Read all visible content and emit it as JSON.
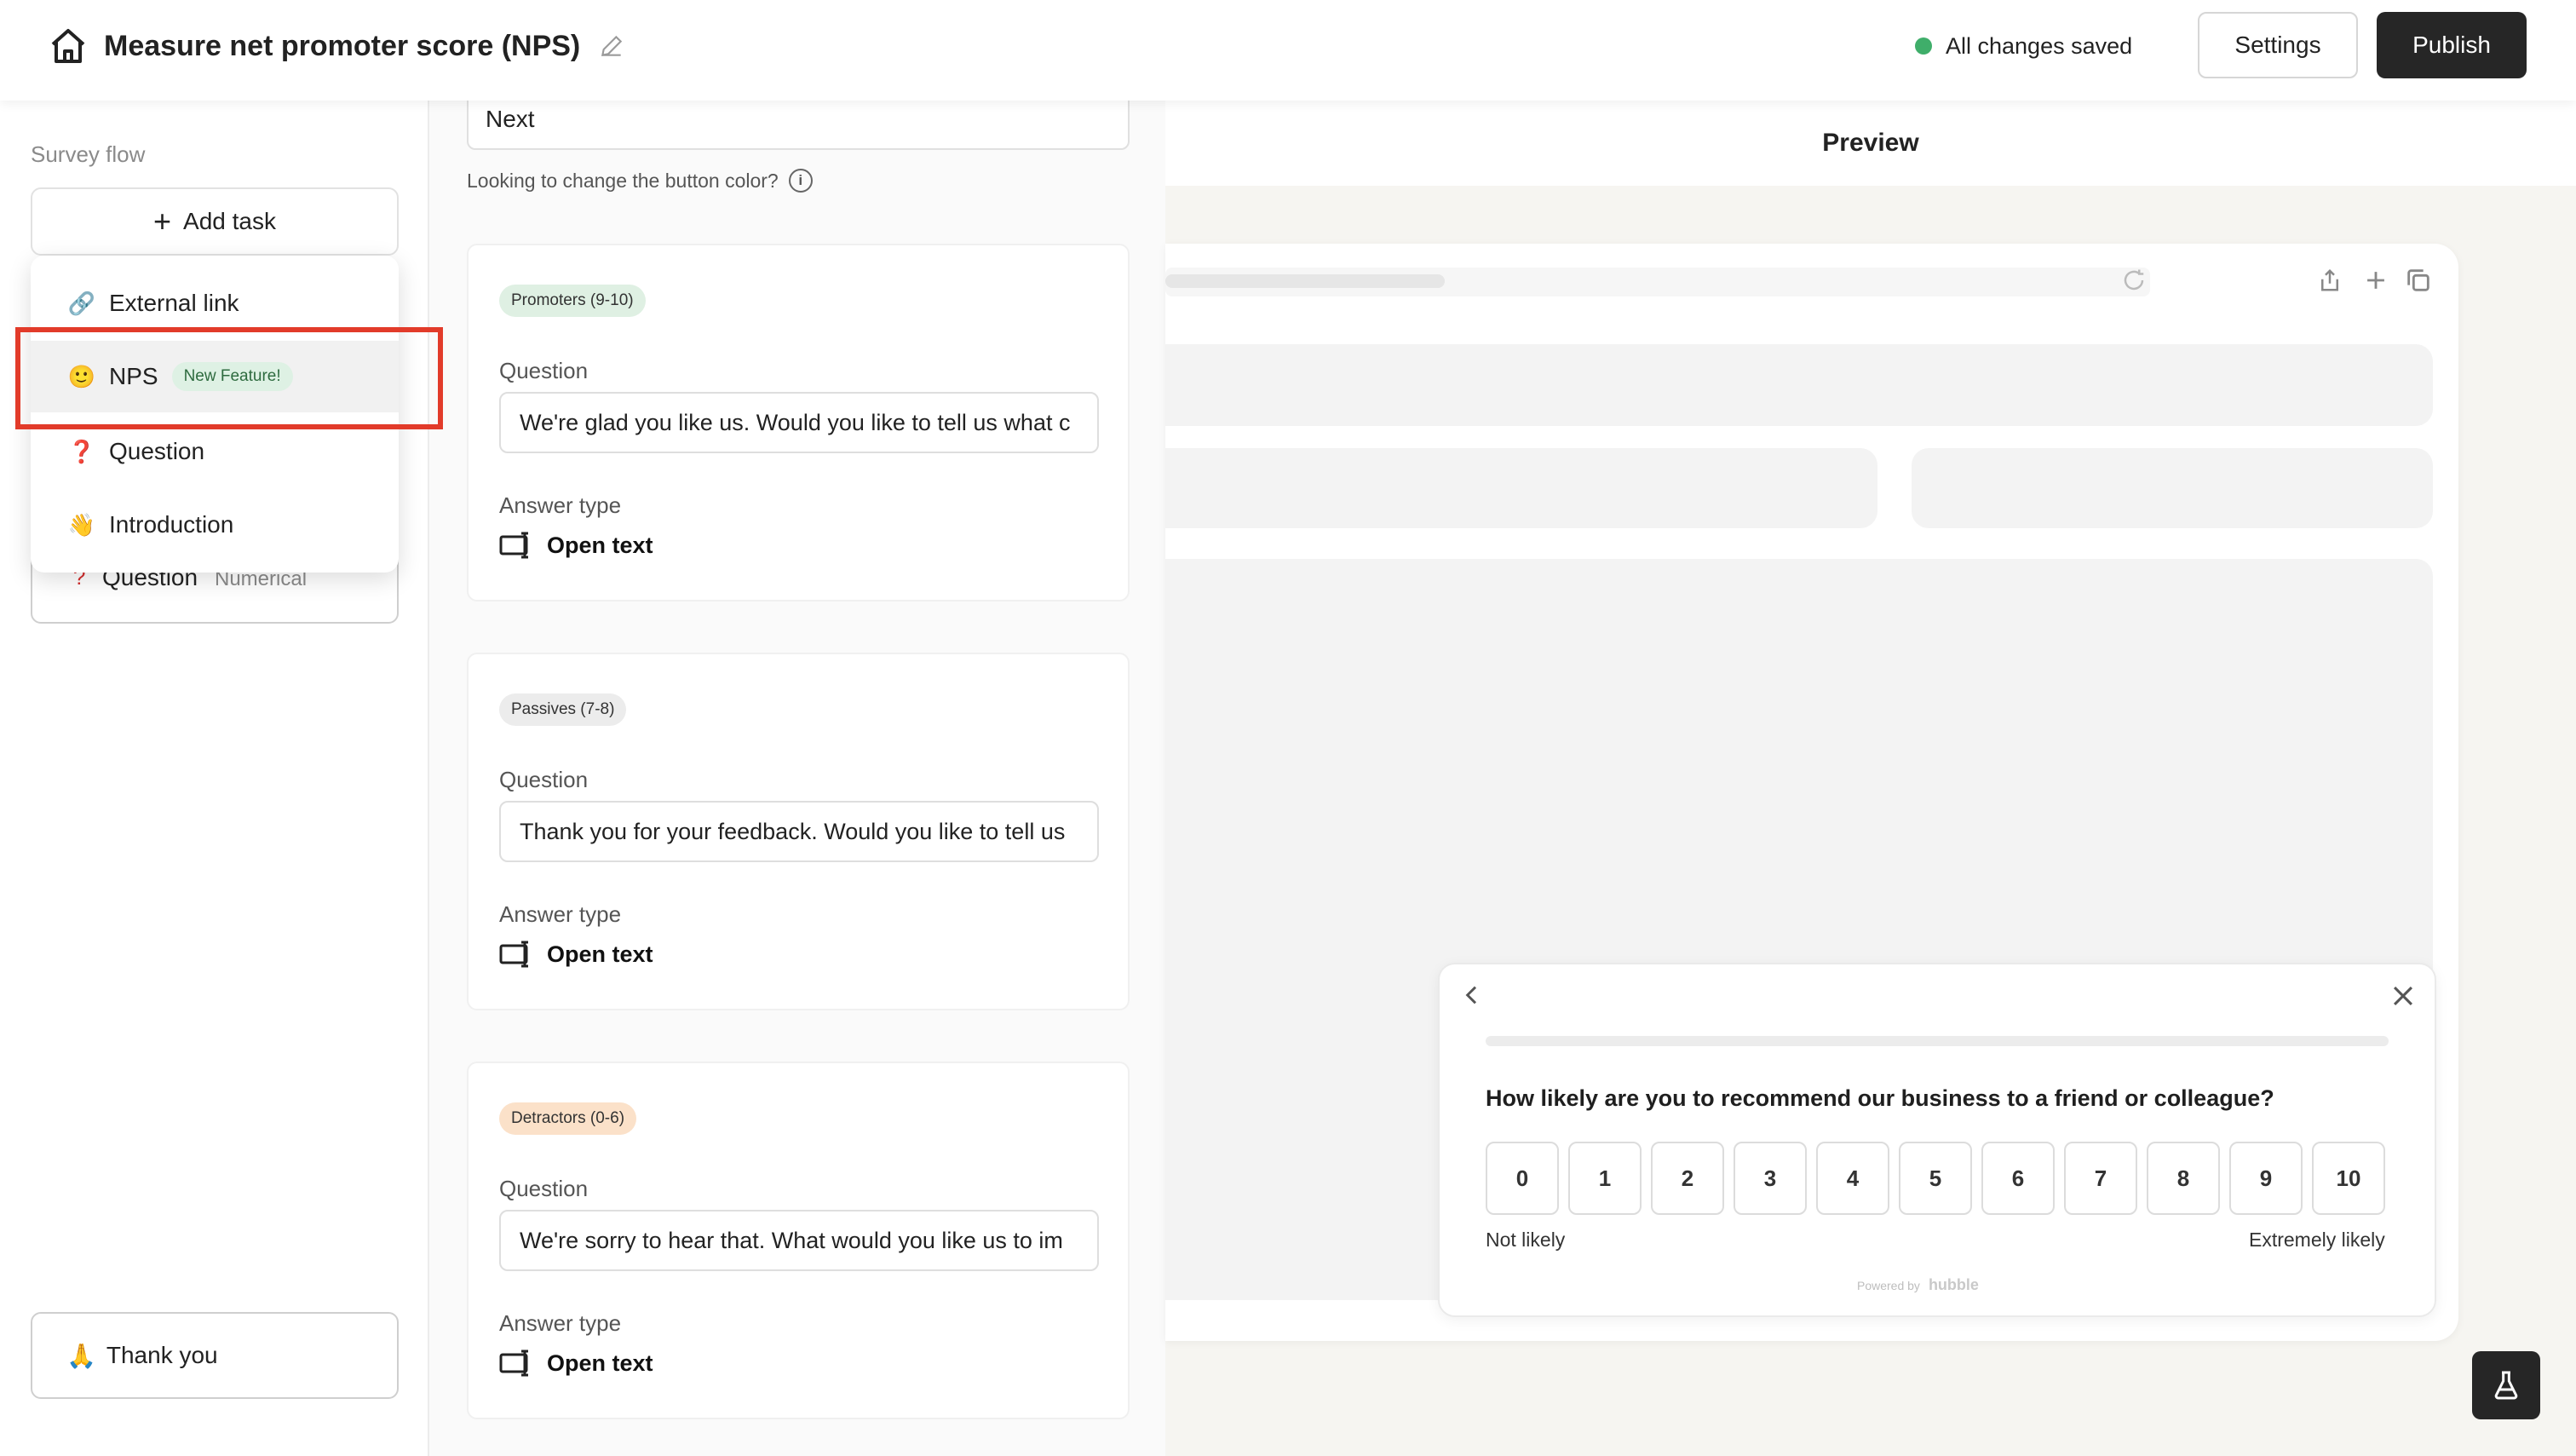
{
  "header": {
    "title": "Measure net promoter score (NPS)",
    "status": "All changes saved",
    "status_color": "#3fae6a",
    "settings_label": "Settings",
    "publish_label": "Publish"
  },
  "sidebar": {
    "section_label": "Survey flow",
    "add_task_label": "Add task",
    "menu": [
      {
        "icon": "link-icon",
        "emoji": "🔗",
        "label": "External link"
      },
      {
        "icon": "smile-icon",
        "emoji": "🙂",
        "label": "NPS",
        "badge": "New Feature!"
      },
      {
        "icon": "question-icon",
        "emoji": "❓",
        "label": "Question"
      },
      {
        "icon": "wave-icon",
        "emoji": "👋",
        "label": "Introduction"
      }
    ],
    "existing_task": {
      "label": "Question",
      "tag": "Numerical"
    },
    "thank_you": {
      "emoji": "🙏",
      "label": "Thank you"
    }
  },
  "editor": {
    "button_text_value": "Next",
    "color_hint": "Looking to change the button color?",
    "segments": [
      {
        "badge": "Promoters (9-10)",
        "question_label": "Question",
        "question_value": "We're glad you like us. Would you like to tell us what c",
        "answer_label": "Answer type",
        "answer_value": "Open text"
      },
      {
        "badge": "Passives (7-8)",
        "question_label": "Question",
        "question_value": "Thank you for your feedback. Would you like to tell us",
        "answer_label": "Answer type",
        "answer_value": "Open text"
      },
      {
        "badge": "Detractors (0-6)",
        "question_label": "Question",
        "question_value": "We're sorry to hear that. What would you like us to im",
        "answer_label": "Answer type",
        "answer_value": "Open text"
      }
    ]
  },
  "preview": {
    "title": "Preview",
    "question": "How likely are you to recommend our business to a friend or colleague?",
    "scores": [
      "0",
      "1",
      "2",
      "3",
      "4",
      "5",
      "6",
      "7",
      "8",
      "9",
      "10"
    ],
    "low_label": "Not likely",
    "high_label": "Extremely likely",
    "powered_by": "Powered by",
    "brand": "hubble"
  }
}
